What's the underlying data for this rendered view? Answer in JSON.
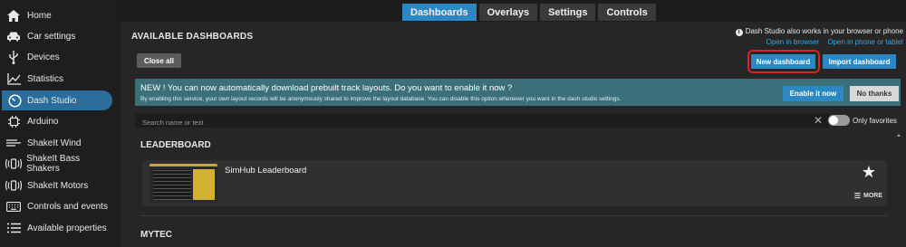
{
  "sidebar": {
    "items": [
      {
        "label": "Home",
        "icon": "home-icon",
        "glyph": "⌂"
      },
      {
        "label": "Car settings",
        "icon": "car-icon",
        "glyph": "🚗"
      },
      {
        "label": "Devices",
        "icon": "usb-icon",
        "glyph": "⍦"
      },
      {
        "label": "Statistics",
        "icon": "chart-icon",
        "glyph": "📈"
      },
      {
        "label": "Dash Studio",
        "icon": "gauge-icon",
        "glyph": "◔"
      },
      {
        "label": "Arduino",
        "icon": "chip-icon",
        "glyph": "▣"
      },
      {
        "label": "ShakeIt Wind",
        "icon": "wind-icon",
        "glyph": "≋"
      },
      {
        "label": "ShakeIt Bass Shakers",
        "icon": "vibration-icon",
        "glyph": "((▯))"
      },
      {
        "label": "ShakeIt Motors",
        "icon": "motor-icon",
        "glyph": "((▯))"
      },
      {
        "label": "Controls and events",
        "icon": "keyboard-icon",
        "glyph": "⌨"
      },
      {
        "label": "Available properties",
        "icon": "list-icon",
        "glyph": "☰"
      }
    ],
    "active_index": 4
  },
  "tabs": [
    {
      "label": "Dashboards"
    },
    {
      "label": "Overlays"
    },
    {
      "label": "Settings"
    },
    {
      "label": "Controls"
    }
  ],
  "main": {
    "title": "AVAILABLE DASHBOARDS",
    "info_text": "Dash Studio also works in your browser or phone",
    "link_browser": "Open in browser",
    "link_phone": "Open in phone or tablet",
    "close_all": "Close all",
    "new_dashboard": "New dashboard",
    "import_dashboard": "Import dashboard",
    "banner": {
      "title": "NEW ! You can now automatically download prebuilt track layouts. Do you want to enable it now ?",
      "desc": "By enabling this service, your own layout records will be anonymously shared to improve the layout database. You can disable this option whenever you want in the dash studio settings.",
      "enable": "Enable it now",
      "no_thanks": "No thanks"
    },
    "search_placeholder": "Search name or text",
    "only_favorites": "Only favorites",
    "sections": [
      {
        "title": "LEADERBOARD",
        "cards": [
          {
            "name": "SimHub Leaderboard",
            "more": "MORE"
          }
        ]
      },
      {
        "title": "MYTEC"
      }
    ]
  }
}
